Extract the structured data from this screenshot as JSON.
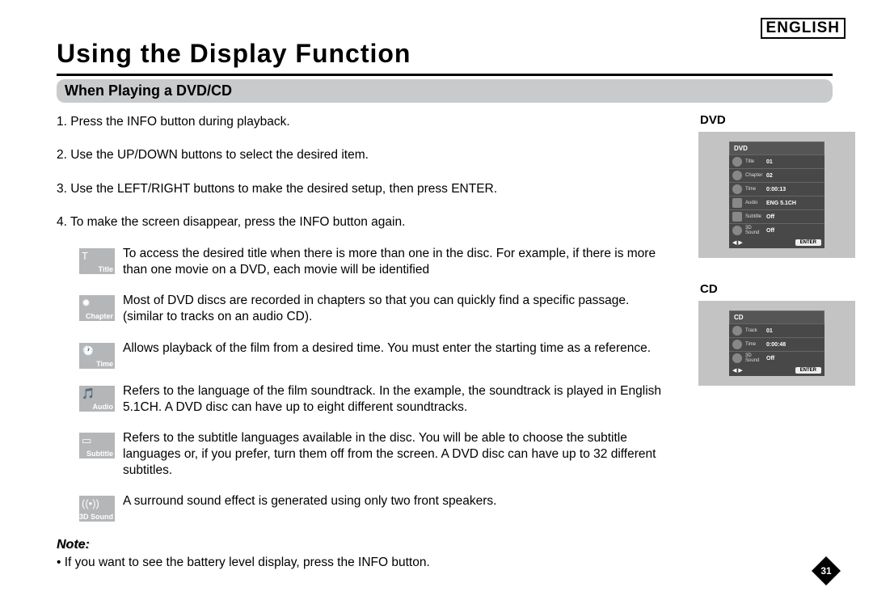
{
  "language_label": "ENGLISH",
  "title": "Using the Display Function",
  "section_header": "When Playing a DVD/CD",
  "steps": [
    "1. Press the INFO button during playback.",
    "2. Use the UP/DOWN buttons to select the desired item.",
    "3. Use the LEFT/RIGHT buttons to make the desired setup, then press ENTER.",
    "4. To make the screen disappear, press the INFO button again."
  ],
  "items": [
    {
      "icon": "T",
      "label": "Title",
      "text": "To access the desired title when there is more than one in the disc.\nFor example, if there is more than one movie on a DVD, each movie will be identified"
    },
    {
      "icon": "✹",
      "label": "Chapter",
      "text": "Most of DVD discs are recorded in chapters so that you can quickly find a specific passage. (similar to tracks on an audio CD)."
    },
    {
      "icon": "🕐",
      "label": "Time",
      "text": "Allows playback of the film from a desired time.\nYou must enter the starting time as a reference."
    },
    {
      "icon": "🎵",
      "label": "Audio",
      "text": "Refers to the language of the film soundtrack. In the example, the soundtrack is played in English 5.1CH. A DVD disc can have up to eight different soundtracks."
    },
    {
      "icon": "▭",
      "label": "Subtitle",
      "text": "Refers to the subtitle languages available in the disc.\nYou will be able to choose the subtitle languages or, if you prefer, turn them off from the screen. A DVD disc can have up to 32 different subtitles."
    },
    {
      "icon": "((•))",
      "label": "3D Sound",
      "text": "A surround sound effect is generated using only two front speakers."
    }
  ],
  "note_heading": "Note:",
  "note_text": "• If you want to see the battery level display, press the INFO button.",
  "osd": {
    "dvd": {
      "label": "DVD",
      "head": "DVD",
      "rows": [
        {
          "cap": "Title",
          "val": "01"
        },
        {
          "cap": "Chapter",
          "val": "02"
        },
        {
          "cap": "Time",
          "val": "0:00:13"
        },
        {
          "cap": "Audio",
          "val": "ENG 5.1CH"
        },
        {
          "cap": "Subtitle",
          "val": "Off"
        },
        {
          "cap": "3D Sound",
          "val": "Off"
        }
      ],
      "enter": "ENTER",
      "arrows": "◀ ▶"
    },
    "cd": {
      "label": "CD",
      "head": "CD",
      "rows": [
        {
          "cap": "Track",
          "val": "01"
        },
        {
          "cap": "Time",
          "val": "0:00:48"
        },
        {
          "cap": "3D Sound",
          "val": "Off"
        }
      ],
      "enter": "ENTER",
      "arrows": "◀ ▶"
    }
  },
  "page_number": "31"
}
